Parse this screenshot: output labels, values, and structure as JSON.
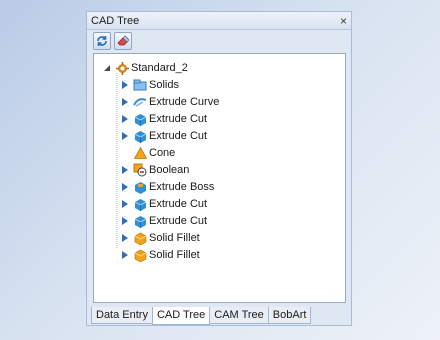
{
  "window": {
    "title": "CAD Tree",
    "close_glyph": "×"
  },
  "toolbar": {
    "buttons": [
      {
        "icon": "refresh-icon"
      },
      {
        "icon": "eraser-icon"
      }
    ]
  },
  "tree": {
    "root": {
      "label": "Standard_2",
      "icon": "gear-icon",
      "expanded": true
    },
    "items": [
      {
        "label": "Solids",
        "icon": "solids-folder-icon"
      },
      {
        "label": "Extrude Curve",
        "icon": "extrude-curve-icon"
      },
      {
        "label": "Extrude Cut",
        "icon": "extrude-cut-icon"
      },
      {
        "label": "Extrude Cut",
        "icon": "extrude-cut-icon"
      },
      {
        "label": "Cone",
        "icon": "cone-icon",
        "leaf": true
      },
      {
        "label": "Boolean",
        "icon": "boolean-icon"
      },
      {
        "label": "Extrude Boss",
        "icon": "extrude-boss-icon"
      },
      {
        "label": "Extrude Cut",
        "icon": "extrude-cut-icon"
      },
      {
        "label": "Extrude Cut",
        "icon": "extrude-cut-icon"
      },
      {
        "label": "Solid Fillet",
        "icon": "solid-fillet-icon"
      },
      {
        "label": "Solid Fillet",
        "icon": "solid-fillet-icon"
      }
    ]
  },
  "tabs": [
    {
      "label": "Data Entry",
      "active": false
    },
    {
      "label": "CAD Tree",
      "active": true
    },
    {
      "label": "CAM Tree",
      "active": false
    },
    {
      "label": "BobArt",
      "active": false
    }
  ],
  "colors": {
    "accent": "#2f8fd8",
    "cone": "#f0a21b"
  }
}
